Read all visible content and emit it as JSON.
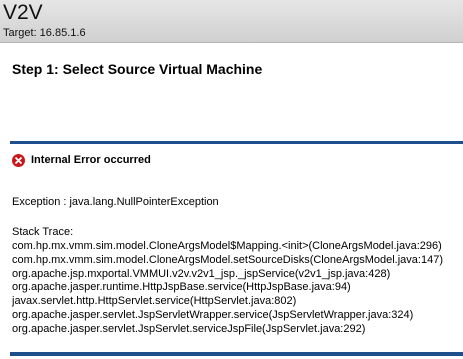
{
  "header": {
    "app_title": "V2V",
    "target": "Target: 16.85.1.6"
  },
  "step": {
    "title": "Step 1: Select Source Virtual Machine"
  },
  "error": {
    "icon": "error-icon",
    "heading": "Internal Error occurred",
    "exception": "Exception : java.lang.NullPointerException",
    "trace_label": "Stack Trace:",
    "trace": [
      "com.hp.mx.vmm.sim.model.CloneArgsModel$Mapping.<init>(CloneArgsModel.java:296)",
      "com.hp.mx.vmm.sim.model.CloneArgsModel.setSourceDisks(CloneArgsModel.java:147)",
      "org.apache.jsp.mxportal.VMMUI.v2v.v2v1_jsp._jspService(v2v1_jsp.java:428)",
      "org.apache.jasper.runtime.HttpJspBase.service(HttpJspBase.java:94)",
      "javax.servlet.http.HttpServlet.service(HttpServlet.java:802)",
      "org.apache.jasper.servlet.JspServletWrapper.service(JspServletWrapper.java:324)",
      "org.apache.jasper.servlet.JspServlet.serviceJspFile(JspServlet.java:292)"
    ]
  },
  "colors": {
    "rule": "#1f4e8c",
    "error_icon": "#c8171b",
    "header_bg": "#d8d8d8"
  }
}
